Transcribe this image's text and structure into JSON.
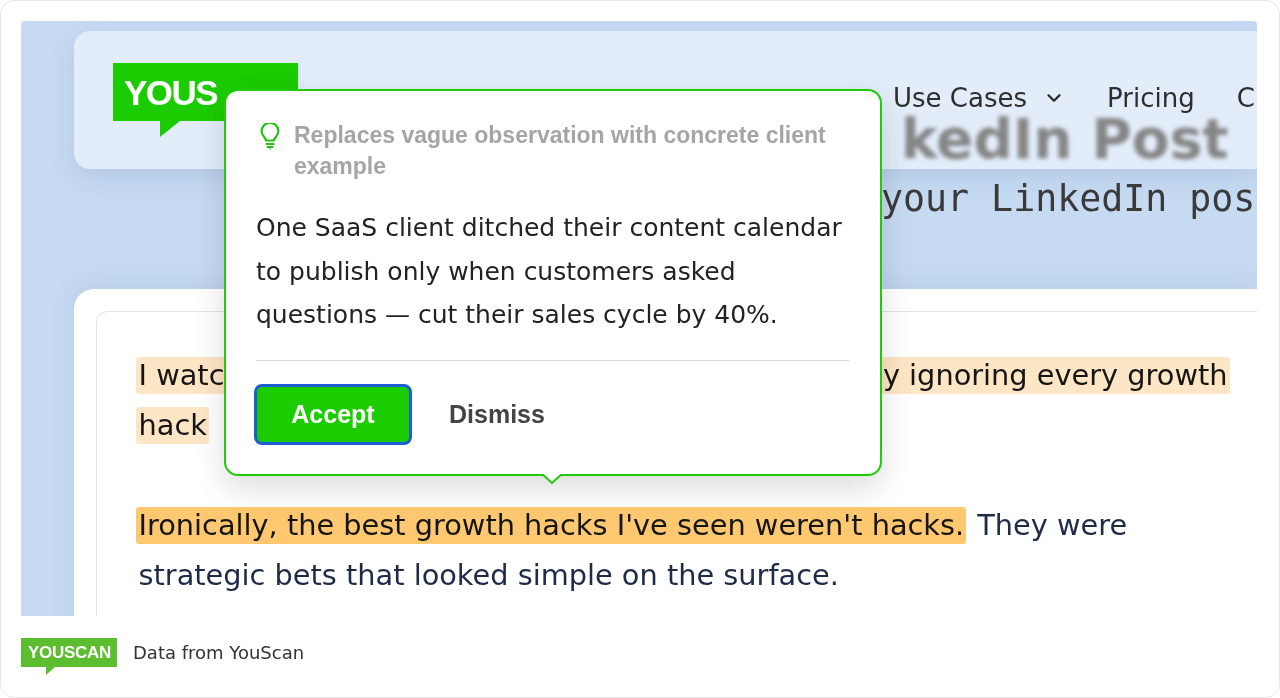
{
  "header": {
    "logo": "YOUS",
    "nav": [
      {
        "label": "Use Cases",
        "dropdown": true
      },
      {
        "label": "Pricing",
        "dropdown": false
      },
      {
        "label": "C",
        "dropdown": false
      }
    ],
    "blurred_title": "kedIn Post"
  },
  "subtitle": "your LinkedIn pos",
  "editor": {
    "paragraphs": [
      {
        "lines": [
          {
            "start": [
              {
                "text": "I watc",
                "color": "#fde6c5"
              }
            ],
            "end": [
              {
                "text": "y ignoring every growth",
                "color": "#fde6c5"
              }
            ]
          },
          {
            "start": [
              {
                "text": "hack",
                "color": "#fde6c5"
              }
            ]
          }
        ]
      },
      {
        "lines": [
          {
            "start": [
              {
                "text": "Ironically, the best growth hacks I've seen weren't hacks.",
                "color": "#fec870"
              },
              {
                "text": "They were"
              }
            ]
          },
          {
            "start": [
              {
                "text": "strategic bets that looked simple on the surface."
              }
            ]
          }
        ]
      }
    ]
  },
  "suggestion": {
    "reason": "Replaces vague observation with concrete client example",
    "text": "One SaaS client ditched their content calendar to publish only when customers asked questions — cut their sales cycle by 40%.",
    "actions": [
      {
        "label": "Accept",
        "kind": "primary",
        "focused": true
      },
      {
        "label": "Dismiss",
        "kind": "text",
        "focused": false
      }
    ]
  },
  "footer": {
    "logo": "YOUSCAN",
    "source": "Data from YouScan"
  }
}
